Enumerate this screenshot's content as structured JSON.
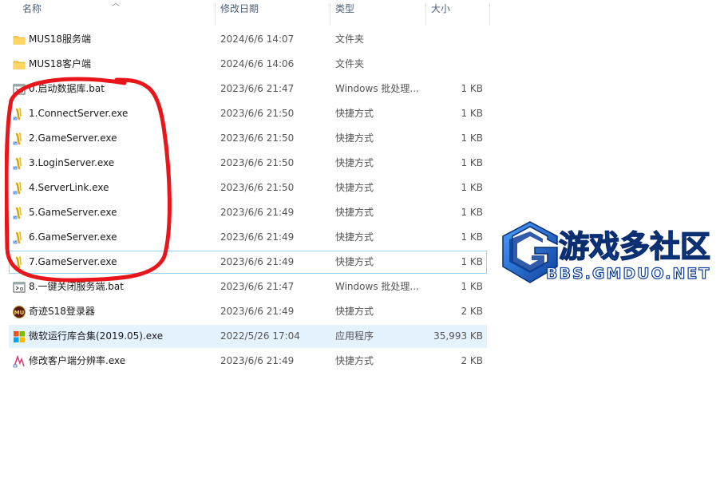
{
  "columns": {
    "name": "名称",
    "date": "修改日期",
    "type": "类型",
    "size": "大小"
  },
  "files": [
    {
      "name": "MUS18服务端",
      "date": "2024/6/6 14:07",
      "type": "文件夹",
      "size": "",
      "icon": "folder-icon"
    },
    {
      "name": "MUS18客户端",
      "date": "2024/6/6 14:06",
      "type": "文件夹",
      "size": "",
      "icon": "folder-icon"
    },
    {
      "name": "0.启动数据库.bat",
      "date": "2023/6/6 21:47",
      "type": "Windows 批处理...",
      "size": "1 KB",
      "icon": "batch-file-icon"
    },
    {
      "name": "1.ConnectServer.exe",
      "date": "2023/6/6 21:50",
      "type": "快捷方式",
      "size": "1 KB",
      "icon": "shortcut-icon"
    },
    {
      "name": "2.GameServer.exe",
      "date": "2023/6/6 21:50",
      "type": "快捷方式",
      "size": "1 KB",
      "icon": "shortcut-icon"
    },
    {
      "name": "3.LoginServer.exe",
      "date": "2023/6/6 21:50",
      "type": "快捷方式",
      "size": "1 KB",
      "icon": "shortcut-icon"
    },
    {
      "name": "4.ServerLink.exe",
      "date": "2023/6/6 21:50",
      "type": "快捷方式",
      "size": "1 KB",
      "icon": "shortcut-icon"
    },
    {
      "name": "5.GameServer.exe",
      "date": "2023/6/6 21:49",
      "type": "快捷方式",
      "size": "1 KB",
      "icon": "shortcut-icon"
    },
    {
      "name": "6.GameServer.exe",
      "date": "2023/6/6 21:49",
      "type": "快捷方式",
      "size": "1 KB",
      "icon": "shortcut-icon"
    },
    {
      "name": "7.GameServer.exe",
      "date": "2023/6/6 21:49",
      "type": "快捷方式",
      "size": "1 KB",
      "icon": "shortcut-icon",
      "state": "focused"
    },
    {
      "name": "8.一键关闭服务端.bat",
      "date": "2023/6/6 21:47",
      "type": "Windows 批处理...",
      "size": "1 KB",
      "icon": "batch-file-icon"
    },
    {
      "name": "奇迹S18登录器",
      "date": "2023/6/6 21:49",
      "type": "快捷方式",
      "size": "2 KB",
      "icon": "launcher-icon"
    },
    {
      "name": "微软运行库合集(2019.05).exe",
      "date": "2022/5/26 17:04",
      "type": "应用程序",
      "size": "35,993 KB",
      "icon": "windows-app-icon",
      "state": "hover"
    },
    {
      "name": "修改客户端分辨率.exe",
      "date": "2023/6/6 21:49",
      "type": "快捷方式",
      "size": "2 KB",
      "icon": "resolution-tool-icon"
    }
  ],
  "watermark": {
    "title": "游戏多社区",
    "url": "BBS.GMDUO.NET"
  },
  "colors": {
    "header_text": "#4c607a",
    "selection": "#cce8ff",
    "focus_border": "#99d1ff",
    "annotation": "#e8161b",
    "logo_blue": "#1565c0"
  }
}
